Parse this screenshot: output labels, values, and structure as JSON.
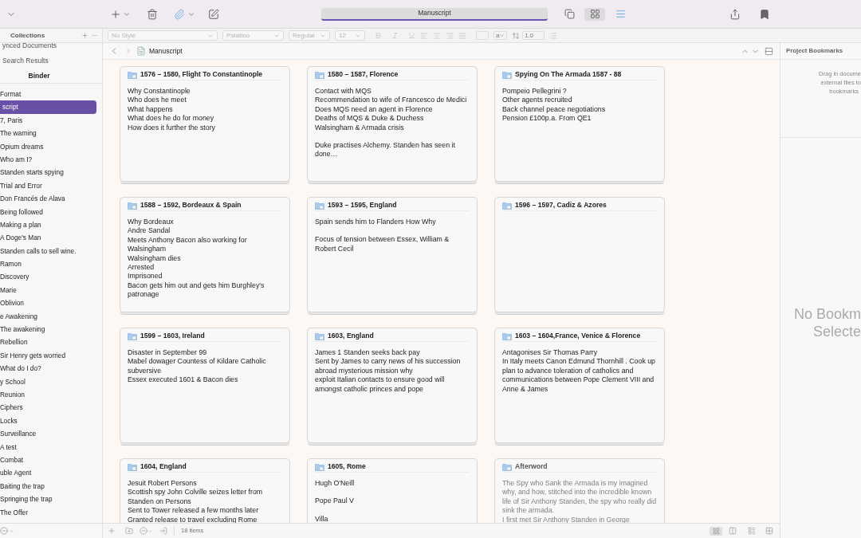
{
  "toolbar": {
    "document_title": "Manuscript",
    "view_modes": [
      {
        "selected": false
      },
      {
        "selected": true
      },
      {
        "selected": false
      }
    ]
  },
  "format_bar": {
    "style": "No Style",
    "font": "Palatino",
    "weight": "Regular",
    "size": "12",
    "case_menu": "a",
    "line_spacing": "1.0"
  },
  "sidebar": {
    "header": "Collections",
    "sections": [
      "ynced Documents",
      "Search Results"
    ],
    "binder_label": "Binder",
    "items": [
      {
        "label": "Format",
        "selected": false
      },
      {
        "label": "script",
        "selected": true
      },
      {
        "label": "7, Paris",
        "selected": false
      },
      {
        "label": "The warning",
        "selected": false
      },
      {
        "label": "Opium dreams",
        "selected": false
      },
      {
        "label": "Who am I?",
        "selected": false
      },
      {
        "label": "Standen starts spying",
        "selected": false
      },
      {
        "label": "Trial and Error",
        "selected": false
      },
      {
        "label": "Don Francés de Alava",
        "selected": false
      },
      {
        "label": "Being followed",
        "selected": false
      },
      {
        "label": "Making a plan",
        "selected": false
      },
      {
        "label": "A Doge's Man",
        "selected": false
      },
      {
        "label": "Standen calls to sell wine.",
        "selected": false
      },
      {
        "label": "Ramon",
        "selected": false
      },
      {
        "label": "Discovery",
        "selected": false
      },
      {
        "label": "Marie",
        "selected": false
      },
      {
        "label": "Oblivion",
        "selected": false
      },
      {
        "label": "e Awakening",
        "selected": false
      },
      {
        "label": "The awakening",
        "selected": false
      },
      {
        "label": "Rebellion",
        "selected": false
      },
      {
        "label": "Sir Henry gets worried",
        "selected": false
      },
      {
        "label": "What do I do?",
        "selected": false
      },
      {
        "label": "y School",
        "selected": false
      },
      {
        "label": "Reunion",
        "selected": false
      },
      {
        "label": "Ciphers",
        "selected": false
      },
      {
        "label": "Locks",
        "selected": false
      },
      {
        "label": "Surveillance",
        "selected": false
      },
      {
        "label": "A test",
        "selected": false
      },
      {
        "label": "Combat",
        "selected": false
      },
      {
        "label": "uble Agent",
        "selected": false
      },
      {
        "label": "Baiting the trap",
        "selected": false
      },
      {
        "label": "Springing the trap",
        "selected": false
      },
      {
        "label": "The Offer",
        "selected": false
      }
    ]
  },
  "corkboard": {
    "path": "Manuscript",
    "item_count": "18 items",
    "cards": [
      {
        "title": "1576 – 1580, Flight To Constantinople",
        "muted": false,
        "paragraphs": [
          [
            "Why Constantinople",
            "Who does he meet",
            "What happens",
            "What does he do for money",
            "How does it further the story"
          ]
        ]
      },
      {
        "title": "1580 – 1587, Florence",
        "muted": false,
        "paragraphs": [
          [
            "Contact with MQS",
            "Recommendation to wife of Francesco de Medici",
            "Does MQS need an agent in Florence",
            "Deaths of MQS & Duke & Duchess",
            "Walsingham & Armada crisis"
          ],
          [
            "Duke practises Alchemy. Standen has seen it done…"
          ]
        ]
      },
      {
        "title": "Spying On The Armada 1587 - 88",
        "muted": false,
        "paragraphs": [
          [
            "Pompeio Pellegrini ?",
            "Other agents recruited",
            "Back channel peace negotiations",
            "Pension £100p.a. From QE1"
          ]
        ]
      },
      {
        "title": "1588 – 1592, Bordeaux & Spain",
        "muted": false,
        "paragraphs": [
          [
            "Why Bordeaux",
            "Andre Sandal",
            "Meets Anthony Bacon also working for Walsingham",
            "Walsingham dies",
            "Arrested",
            "Imprisoned",
            "Bacon gets him out and gets him Burghley's patronage"
          ]
        ]
      },
      {
        "title": "1593 – 1595, England",
        "muted": false,
        "paragraphs": [
          [
            "Spain sends him to Flanders How Why"
          ],
          [
            "Focus of tension between Essex, William & Robert Cecil"
          ]
        ]
      },
      {
        "title": "1596 – 1597, Cadiz & Azores",
        "muted": false
      },
      {
        "title": "1599 – 1603, Ireland",
        "muted": false,
        "paragraphs": [
          [
            "Disaster in September 99",
            "Mabel dowager Countess of Kildare Catholic subversive",
            "Essex executed 1601 & Bacon dies"
          ]
        ]
      },
      {
        "title": "1603, England",
        "muted": false,
        "paragraphs": [
          [
            "James 1 Standen seeks back pay",
            "Sent by James to carry news of his succession abroad mysterious mission why",
            "exploit Italian contacts to ensure good will amongst catholic princes and pope"
          ]
        ]
      },
      {
        "title": "1603 – 1604,France, Venice & Florence",
        "muted": false,
        "paragraphs": [
          [
            "Antagonises Sir Thomas Parry",
            "In Italy meets Canon Edmund Thornhill . Cook up plan to advance toleration of catholics and communications between Pope Clement VIII and Anne & James"
          ]
        ]
      },
      {
        "title": "1604, England",
        "muted": false,
        "paragraphs": [
          [
            "Jesuit Robert Persons",
            "Scottish spy John Colville seizes letter from Standen on Persons",
            "Sent to Tower released a few months later",
            "Granted release to travel excluding Rome"
          ]
        ]
      },
      {
        "title": "1605, Rome",
        "muted": false,
        "paragraphs": [
          [
            "Hugh O'Neill"
          ],
          [
            "Pope Paul V"
          ],
          [
            "Villa"
          ]
        ]
      },
      {
        "title": "Afterword",
        "muted": true,
        "paragraphs": [
          [
            "The Spy who Sank the Armada is my imagined why, and how, stitched into the incredible known life of Sir Anthony Standen, the spy who really did sink the armada.",
            "I first met Sir Anthony Standen in George"
          ]
        ]
      }
    ]
  },
  "inspector": {
    "header": "Project Bookmarks",
    "hint_lines": [
      "Drag in docume",
      "external files to",
      "bookmarks"
    ],
    "empty_lines": [
      "No Bookm",
      "Selecte"
    ]
  }
}
